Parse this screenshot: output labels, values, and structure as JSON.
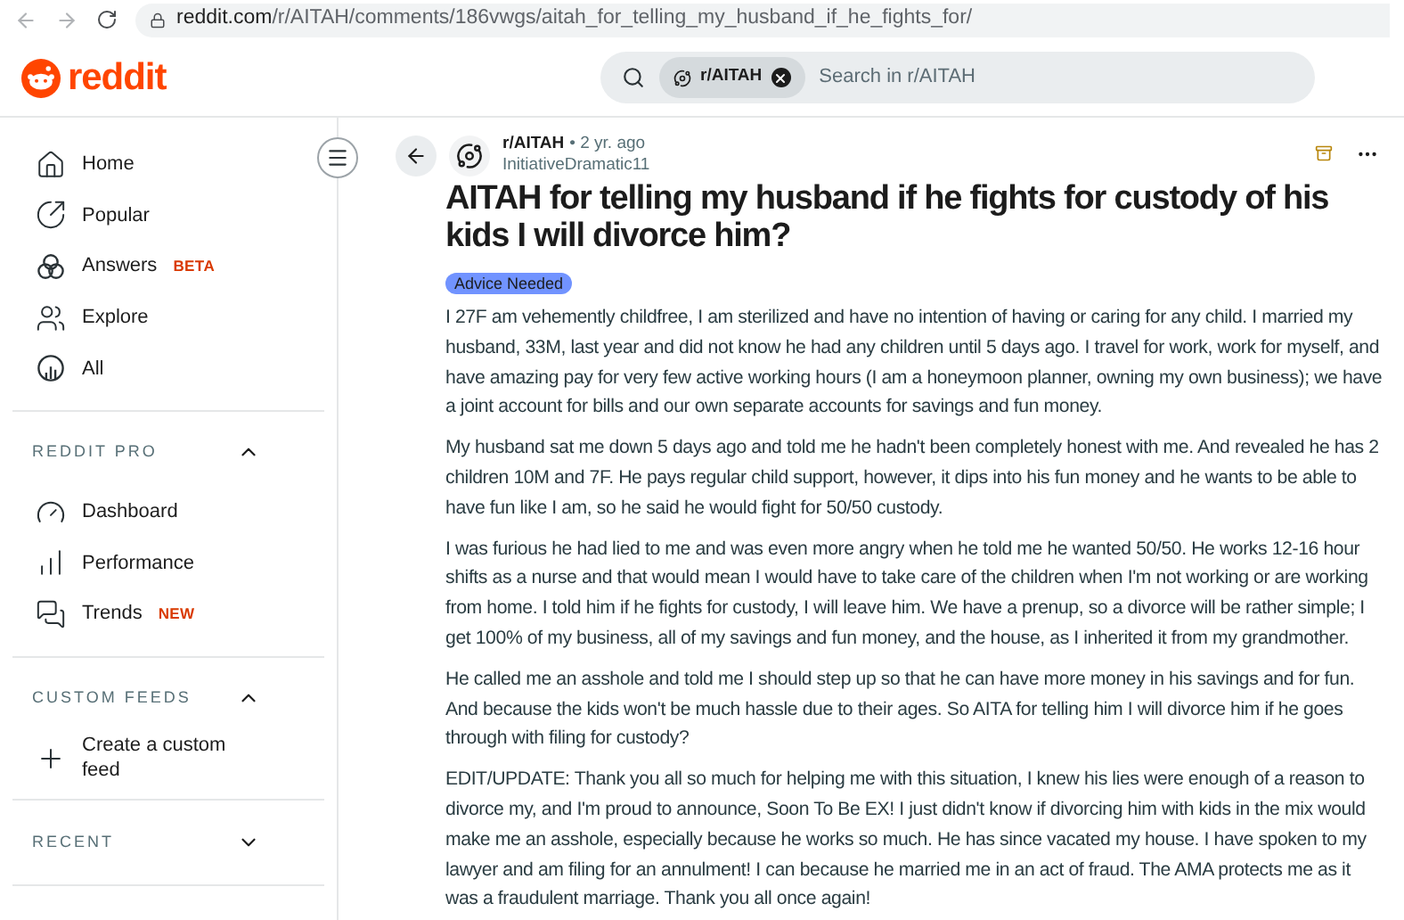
{
  "browser": {
    "url_host": "reddit.com",
    "url_path": "/r/AITAH/comments/186vwgs/aitah_for_telling_my_husband_if_he_fights_for/"
  },
  "header": {
    "logo": "reddit",
    "search": {
      "chip": "r/AITAH",
      "placeholder": "Search in r/AITAH"
    }
  },
  "sidebar": {
    "items": [
      {
        "label": "Home"
      },
      {
        "label": "Popular"
      },
      {
        "label": "Answers",
        "badge": "BETA"
      },
      {
        "label": "Explore"
      },
      {
        "label": "All"
      }
    ],
    "sections": [
      {
        "title": "REDDIT PRO",
        "expanded": true,
        "items": [
          {
            "label": "Dashboard"
          },
          {
            "label": "Performance"
          },
          {
            "label": "Trends",
            "badge": "NEW"
          }
        ]
      },
      {
        "title": "CUSTOM FEEDS",
        "expanded": true,
        "items": [
          {
            "label": "Create a custom feed"
          }
        ]
      },
      {
        "title": "RECENT",
        "expanded": false
      }
    ]
  },
  "post": {
    "subreddit": "r/AITAH",
    "age": "• 2 yr. ago",
    "author": "InitiativeDramatic11",
    "title": "AITAH for telling my husband if he fights for custody of his kids I will divorce him?",
    "flair": "Advice Needed",
    "paragraphs": [
      "I 27F am vehemently childfree, I am sterilized and have no intention of having or caring for any child. I married my husband, 33M, last year and did not know he had any children until 5 days ago. I travel for work, work for myself, and have amazing pay for very few active working hours (I am a honeymoon planner, owning my own business); we have a joint account for bills and our own separate accounts for savings and fun money.",
      "My husband sat me down 5 days ago and told me he hadn't been completely honest with me. And revealed he has 2 children 10M and 7F. He pays regular child support, however, it dips into his fun money and he wants to be able to have fun like I am, so he said he would fight for 50/50 custody.",
      "I was furious he had lied to me and was even more angry when he told me he wanted 50/50. He works 12-16 hour shifts as a nurse and that would mean I would have to take care of the children when I'm not working or are working from home. I told him if he fights for custody, I will leave him. We have a prenup, so a divorce will be rather simple; I get 100% of my business, all of my savings and fun money, and the house, as I inherited it from my grandmother.",
      "He called me an asshole and told me I should step up so that he can have more money in his savings and for fun. And because the kids won't be much hassle due to their ages. So AITA for telling him I will divorce him if he goes through with filing for custody?",
      "EDIT/UPDATE: Thank you all so much for helping me with this situation, I knew his lies were enough of a reason to divorce my, and I'm proud to announce, Soon To Be EX! I just didn't know if divorcing him with kids in the mix would make me an asshole, especially because he works so much. He has since vacated my house. I have spoken to my lawyer and am filing for an annulment! I can because he married me in an act of fraud. The AMA protects me as it was a fraudulent marriage. Thank you all once again!"
    ]
  }
}
